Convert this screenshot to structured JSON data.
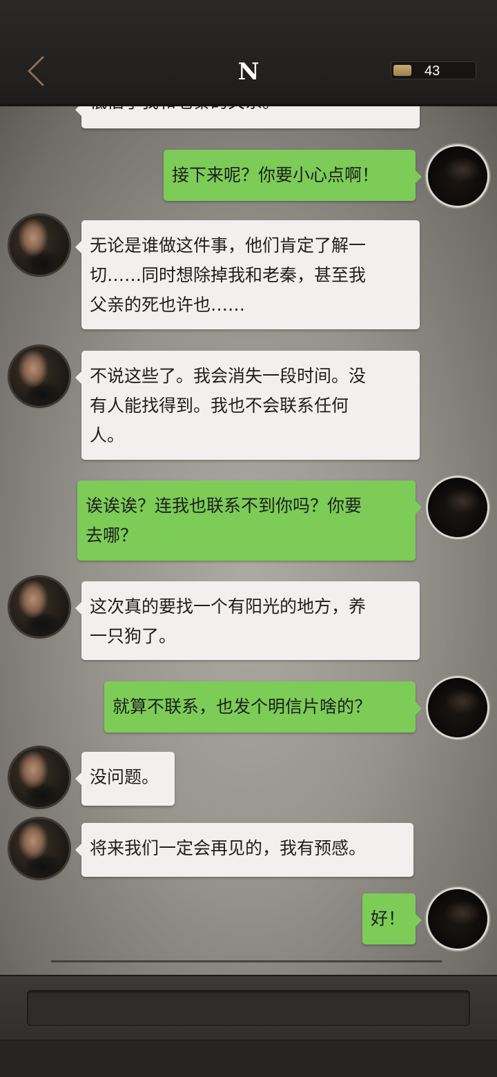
{
  "header": {
    "title": "N",
    "back_icon": "chevron-left-icon",
    "counter_value": "43",
    "colors": {
      "accent": "#b5976a",
      "background": "#232120"
    }
  },
  "messages": [
    {
      "side": "in",
      "text": "低估了我和老秦的关系。"
    },
    {
      "side": "out",
      "text": "接下来呢？你要小心点啊！"
    },
    {
      "side": "in",
      "lines": [
        "无论是谁做这件事，他们肯定了解一",
        "切……同时想除掉我和老秦，甚至我",
        "父亲的死也许也……"
      ]
    },
    {
      "side": "in",
      "lines": [
        "不说这些了。我会消失一段时间。没",
        "有人能找得到。我也不会联系任何",
        "人。"
      ]
    },
    {
      "side": "out",
      "lines": [
        "诶诶诶？连我也联系不到你吗？你要",
        "去哪？"
      ]
    },
    {
      "side": "in",
      "lines": [
        "这次真的要找一个有阳光的地方，养",
        "一只狗了。"
      ]
    },
    {
      "side": "out",
      "text": "就算不联系，也发个明信片啥的？"
    },
    {
      "side": "in",
      "text": "没问题。"
    },
    {
      "side": "in",
      "text": "将来我们一定会再见的，我有预感。"
    },
    {
      "side": "out",
      "text": "好！"
    }
  ],
  "colors": {
    "incoming_bubble": "#f1f0ee",
    "outgoing_bubble": "#7ccc57",
    "text": "#1e1e1e"
  }
}
